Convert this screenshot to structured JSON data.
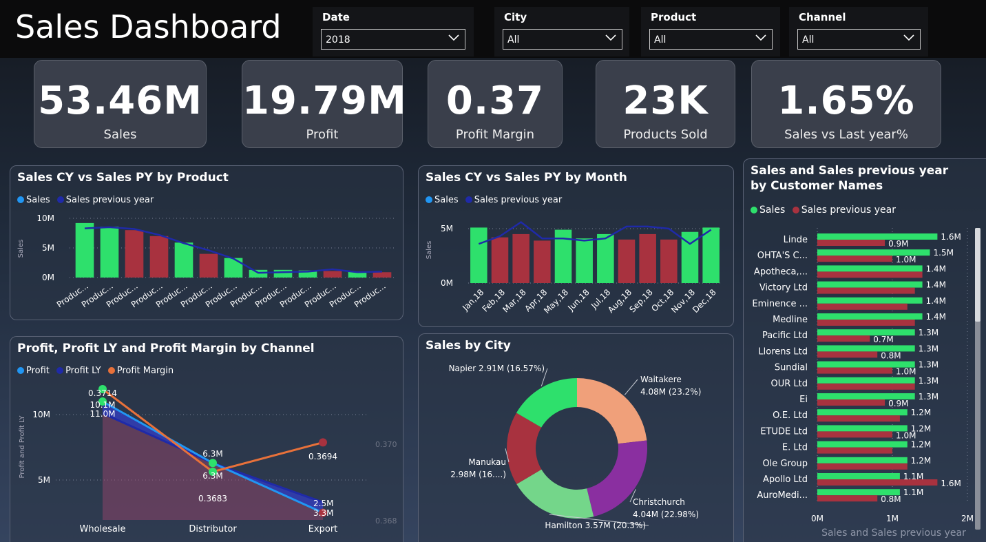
{
  "header": {
    "title": "Sales Dashboard"
  },
  "slicers": [
    {
      "label": "Date",
      "value": "2018"
    },
    {
      "label": "City",
      "value": "All"
    },
    {
      "label": "Product",
      "value": "All"
    },
    {
      "label": "Channel",
      "value": "All"
    }
  ],
  "kpis": [
    {
      "value": "53.46M",
      "caption": "Sales"
    },
    {
      "value": "19.79M",
      "caption": "Profit"
    },
    {
      "value": "0.37",
      "caption": "Profit Margin"
    },
    {
      "value": "23K",
      "caption": "Products Sold"
    },
    {
      "value": "1.65%",
      "caption": "Sales vs Last year%"
    }
  ],
  "colors": {
    "sales": "#2ee06c",
    "sales_below": "#a8323f",
    "prev_year": "#1f2aa8",
    "legend_sales": "#2196f3",
    "profit_margin": "#e8713a",
    "profit": "#2196f3"
  },
  "chart_data": [
    {
      "id": "product",
      "type": "bar",
      "title": "Sales CY vs Sales PY by Product",
      "legend": [
        "Sales",
        "Sales previous year"
      ],
      "ylabel": "Sales",
      "yticks": [
        "10M",
        "5M",
        "0M"
      ],
      "ylim": [
        0,
        10
      ],
      "categories": [
        "Produc...",
        "Produc...",
        "Produc...",
        "Produc...",
        "Produc...",
        "Produc...",
        "Produc...",
        "Produc...",
        "Produc...",
        "Produc...",
        "Produc...",
        "Produc...",
        "Produc..."
      ],
      "series": [
        {
          "name": "Sales",
          "values": [
            9.2,
            8.6,
            8.0,
            7.0,
            5.9,
            4.0,
            3.3,
            1.3,
            1.3,
            1.2,
            1.1,
            1.0,
            0.9
          ]
        },
        {
          "name": "Sales previous year",
          "values": [
            8.3,
            8.5,
            8.2,
            7.2,
            5.8,
            4.6,
            3.2,
            0.8,
            0.9,
            1.0,
            1.4,
            0.9,
            1.0
          ]
        }
      ]
    },
    {
      "id": "month",
      "type": "bar",
      "title": "Sales CY vs Sales PY by Month",
      "legend": [
        "Sales",
        "Sales previous year"
      ],
      "ylabel": "Sales",
      "yticks": [
        "5M",
        "0M"
      ],
      "ylim": [
        0,
        6
      ],
      "categories": [
        "Jan,18",
        "Feb,18",
        "Mar,18",
        "Apr,18",
        "May,18",
        "Jun,18",
        "Jul,18",
        "Aug,18",
        "Sep,18",
        "Oct,18",
        "Nov,18",
        "Dec,18"
      ],
      "series": [
        {
          "name": "Sales",
          "values": [
            5.1,
            4.2,
            4.5,
            3.9,
            4.9,
            4.1,
            4.5,
            4.0,
            4.5,
            4.0,
            4.7,
            5.1
          ]
        },
        {
          "name": "Sales previous year",
          "values": [
            3.6,
            4.3,
            5.6,
            4.1,
            4.1,
            3.9,
            4.1,
            5.2,
            5.2,
            5.0,
            3.6,
            4.9
          ]
        }
      ]
    },
    {
      "id": "channel",
      "type": "line",
      "title": "Profit, Profit LY and Profit Margin by Channel",
      "legend": [
        "Profit",
        "Profit LY",
        "Profit Margin"
      ],
      "ylabel": "Profit and Profit LY",
      "yticks": [
        "10M",
        "5M"
      ],
      "y2ticks": [
        "0.370",
        "0.368"
      ],
      "categories": [
        "Wholesale",
        "Distributor",
        "Export"
      ],
      "series": [
        {
          "name": "Profit",
          "values": [
            11.0,
            6.3,
            2.5
          ],
          "labels": [
            "11.0M",
            "6.3M",
            "2.5M"
          ]
        },
        {
          "name": "Profit LY",
          "values": [
            10.1,
            6.3,
            3.3
          ],
          "labels": [
            "10.1M",
            "6.3M",
            "3.3M"
          ]
        },
        {
          "name": "Profit Margin",
          "values": [
            0.3714,
            0.3683,
            0.3694
          ],
          "labels": [
            "0.3714",
            "0.3683",
            "0.3694"
          ]
        }
      ]
    },
    {
      "id": "city",
      "type": "pie",
      "title": "Sales by City",
      "slices": [
        {
          "name": "Waitakere",
          "label": "Waitakere\n4.08M (23.2%)",
          "value": 23.2,
          "color": "#f0a07a"
        },
        {
          "name": "Christchurch",
          "label": "Christchurch\n4.04M (22.98%)",
          "value": 22.98,
          "color": "#8a2fa0"
        },
        {
          "name": "Hamilton",
          "label": "Hamilton 3.57M (20.3%)",
          "value": 20.3,
          "color": "#74d68a"
        },
        {
          "name": "Manukau",
          "label": "Manukau\n2.98M (16....)",
          "value": 16.95,
          "color": "#a8323f"
        },
        {
          "name": "Napier",
          "label": "Napier 2.91M (16.57%)",
          "value": 16.57,
          "color": "#2ee06c"
        }
      ]
    },
    {
      "id": "customers",
      "type": "bar",
      "title": "Sales and Sales previous year by Customer Names",
      "legend": [
        "Sales",
        "Sales previous year"
      ],
      "xlabel": "Sales and Sales previous year",
      "xticks": [
        "0M",
        "1M",
        "2M"
      ],
      "xlim": [
        0,
        2
      ],
      "categories": [
        "Linde",
        "OHTA'S C...",
        "Apotheca,...",
        "Victory Ltd",
        "Eminence ...",
        "Medline",
        "Pacific Ltd",
        "Llorens Ltd",
        "Sundial",
        "OUR Ltd",
        "Ei",
        "O.E. Ltd",
        "ETUDE Ltd",
        "E. Ltd",
        "Ole Group",
        "Apollo Ltd",
        "AuroMedi..."
      ],
      "series": [
        {
          "name": "Sales",
          "values": [
            1.6,
            1.5,
            1.4,
            1.4,
            1.4,
            1.4,
            1.3,
            1.3,
            1.3,
            1.3,
            1.3,
            1.2,
            1.2,
            1.2,
            1.2,
            1.1,
            1.1
          ],
          "labels": [
            "1.6M",
            "1.5M",
            "1.4M",
            "1.4M",
            "1.4M",
            "1.4M",
            "1.3M",
            "1.3M",
            "1.3M",
            "1.3M",
            "1.3M",
            "1.2M",
            "1.2M",
            "1.2M",
            "1.2M",
            "1.1M",
            "1.1M"
          ]
        },
        {
          "name": "Sales previous year",
          "values": [
            0.9,
            1.0,
            1.4,
            1.3,
            1.2,
            1.3,
            0.7,
            0.8,
            1.0,
            1.3,
            0.9,
            1.1,
            1.0,
            1.0,
            1.2,
            1.6,
            0.8
          ],
          "labels": [
            "0.9M",
            "1.0M",
            "",
            "",
            "",
            "",
            "0.7M",
            "0.8M",
            "1.0M",
            "",
            "0.9M",
            "",
            "1.0M",
            "",
            "",
            "1.6M",
            "0.8M"
          ]
        }
      ]
    }
  ]
}
